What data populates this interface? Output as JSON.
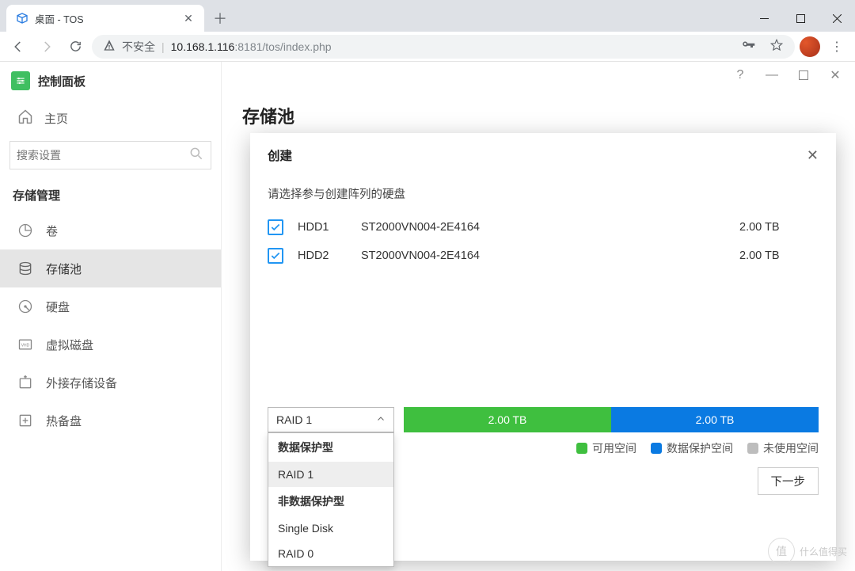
{
  "browser": {
    "tab_title": "桌面 - TOS",
    "url_prefix_label": "不安全",
    "url_host": "10.168.1.116",
    "url_port": ":8181",
    "url_path": "/tos/index.php"
  },
  "sidebar": {
    "panel_title": "控制面板",
    "home_label": "主页",
    "search_placeholder": "搜索设置",
    "section_title": "存储管理",
    "items": [
      {
        "label": "卷"
      },
      {
        "label": "存储池"
      },
      {
        "label": "硬盘"
      },
      {
        "label": "虚拟磁盘"
      },
      {
        "label": "外接存储设备"
      },
      {
        "label": "热备盘"
      }
    ]
  },
  "content": {
    "page_title": "存储池"
  },
  "modal": {
    "title": "创建",
    "hint": "请选择参与创建阵列的硬盘",
    "disks": [
      {
        "name": "HDD1",
        "model": "ST2000VN004-2E4164",
        "capacity": "2.00 TB",
        "checked": true
      },
      {
        "name": "HDD2",
        "model": "ST2000VN004-2E4164",
        "capacity": "2.00 TB",
        "checked": true
      }
    ],
    "raid_selected": "RAID 1",
    "space_segments": [
      {
        "label": "2.00 TB",
        "color": "green",
        "pct": 50
      },
      {
        "label": "2.00 TB",
        "color": "blue",
        "pct": 50
      }
    ],
    "legend": {
      "available": "可用空间",
      "protected": "数据保护空间",
      "unused": "未使用空间"
    },
    "next_button": "下一步",
    "dropdown": {
      "group1": "数据保护型",
      "opt_raid1": "RAID 1",
      "group2": "非数据保护型",
      "opt_single": "Single Disk",
      "opt_raid0": "RAID 0"
    }
  },
  "watermark": "什么值得买"
}
